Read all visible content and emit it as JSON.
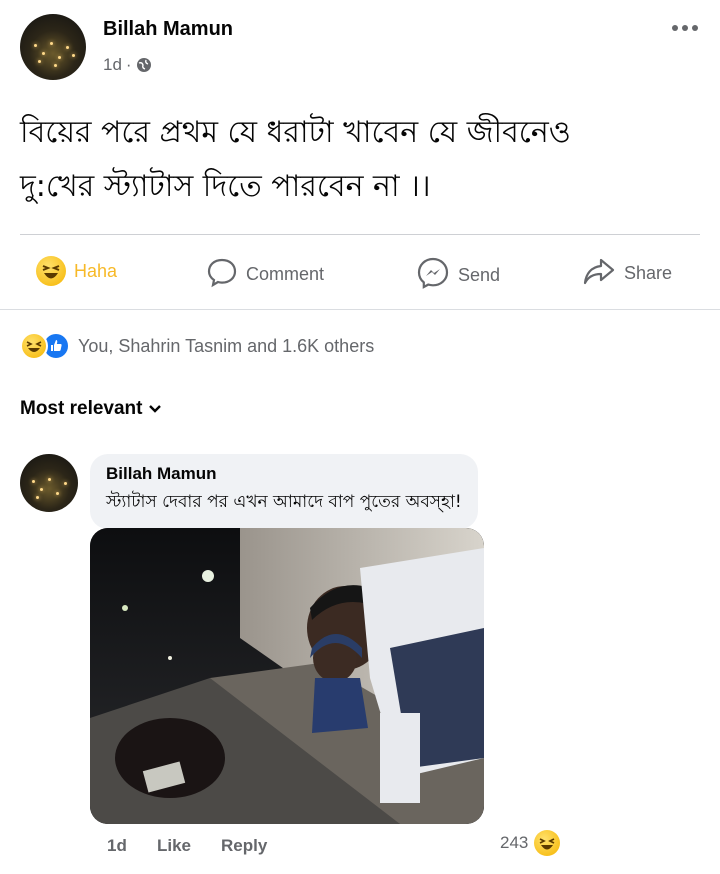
{
  "post": {
    "author": "Billah Mamun",
    "time": "1d",
    "privacy_icon": "globe-icon",
    "more_icon": "more-horizontal-icon",
    "text_line1": "বিয়ের পরে প্রথম যে ধরাটা খাবেন যে জীবনেও",
    "text_line2": "দু:খের স্ট্যাটাস দিতে পারবেন না ।।"
  },
  "actions": {
    "haha": "Haha",
    "comment": "Comment",
    "send": "Send",
    "share": "Share"
  },
  "reactions": {
    "summary": "You, Shahrin Tasnim and 1.6K others",
    "icons": [
      "haha-reaction-icon",
      "like-reaction-icon"
    ]
  },
  "sort": {
    "label": "Most relevant"
  },
  "comment": {
    "author": "Billah Mamun",
    "text": "স্ট্যাটাস দেবার পর এখন আমাদে বাপ পুতের অবস্হা!",
    "time": "1d",
    "like": "Like",
    "reply": "Reply",
    "reaction_count": "243"
  },
  "colors": {
    "haha_yellow": "#f7b928",
    "like_blue": "#1877f2",
    "secondary_text": "#65676b",
    "bubble_bg": "#f0f2f5"
  }
}
